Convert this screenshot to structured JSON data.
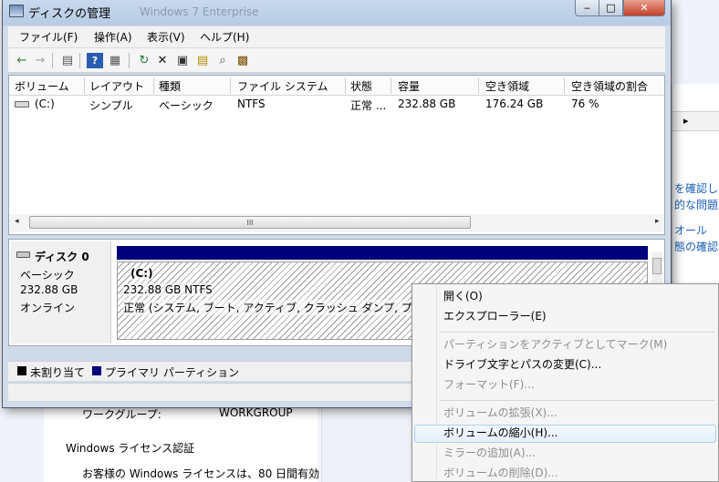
{
  "window": {
    "title": "ディスクの管理",
    "ghost_title": "Windows 7 Enterprise",
    "minimize_glyph": "‒",
    "maximize_glyph": "□",
    "close_glyph": "✕"
  },
  "menu": [
    {
      "label": "ファイル(F)"
    },
    {
      "label": "操作(A)"
    },
    {
      "label": "表示(V)"
    },
    {
      "label": "ヘルプ(H)"
    }
  ],
  "toolbar": [
    {
      "icon": "back-arrow-icon",
      "glyph": "←",
      "color": "#2f7a2f"
    },
    {
      "icon": "forward-arrow-icon",
      "glyph": "→",
      "color": "#9aa59a"
    },
    {
      "icon": "show-hide-console-tree-icon",
      "glyph": "▤",
      "color": "#555555"
    },
    {
      "icon": "help-icon",
      "glyph": "?",
      "color": "#ffffff"
    },
    {
      "icon": "properties-pane-icon",
      "glyph": "▦",
      "color": "#555555"
    },
    {
      "icon": "refresh-icon",
      "glyph": "↻",
      "color": "#1d7a2a"
    },
    {
      "icon": "delete-icon",
      "glyph": "✕",
      "color": "#111111"
    },
    {
      "icon": "properties-icon",
      "glyph": "▣",
      "color": "#333333"
    },
    {
      "icon": "open-folder-icon",
      "glyph": "▤",
      "color": "#b58a00"
    },
    {
      "icon": "search-icon",
      "glyph": "⌕",
      "color": "#555555"
    },
    {
      "icon": "disk-settings-icon",
      "glyph": "▩",
      "color": "#7a4d00"
    }
  ],
  "volume_list": {
    "columns": [
      "ボリューム",
      "レイアウト",
      "種類",
      "ファイル システム",
      "状態",
      "容量",
      "空き領域",
      "空き領域の割合"
    ],
    "rows": [
      {
        "volume": "(C:)",
        "layout": "シンプル",
        "type": "ベーシック",
        "filesystem": "NTFS",
        "status": "正常 ...",
        "capacity": "232.88 GB",
        "free": "176.24 GB",
        "free_pct": "76 %"
      }
    ],
    "scroll_grip": "III"
  },
  "disk": {
    "name": "ディスク 0",
    "type": "ベーシック",
    "size": "232.88 GB",
    "status": "オンライン",
    "partition": {
      "label": "(C:)",
      "size_fs": "232.88 GB NTFS",
      "status": "正常 (システム, ブート, アクティブ, クラッシュ ダンプ, プ"
    }
  },
  "legend": [
    {
      "label": "未割り当て",
      "color": "#000000"
    },
    {
      "label": "プライマリ パーティション",
      "color": "#00007a"
    }
  ],
  "context_menu": {
    "items": [
      {
        "label": "開く(O)",
        "disabled": false
      },
      {
        "label": "エクスプローラー(E)",
        "disabled": false
      },
      {
        "separator": true
      },
      {
        "label": "パーティションをアクティブとしてマーク(M)",
        "disabled": true
      },
      {
        "label": "ドライブ文字とパスの変更(C)...",
        "disabled": false
      },
      {
        "label": "フォーマット(F)...",
        "disabled": true
      },
      {
        "separator": true
      },
      {
        "label": "ボリュームの拡張(X)...",
        "disabled": true
      },
      {
        "label": "ボリュームの縮小(H)...",
        "disabled": false,
        "hover": true
      },
      {
        "label": "ミラーの追加(A)...",
        "disabled": true
      },
      {
        "label": "ボリュームの削除(D)...",
        "disabled": true
      }
    ]
  },
  "background": {
    "side_links": [
      "を確認し",
      "的な問題の",
      "オール",
      "態の確認"
    ],
    "side_arrow": "▸",
    "workgroup_label": "ワークグループ:",
    "workgroup_value": "WORKGROUP",
    "license_heading": "Windows ライセンス認証",
    "license_text": "お客様の Windows ライセンスは、80 日間有効"
  }
}
